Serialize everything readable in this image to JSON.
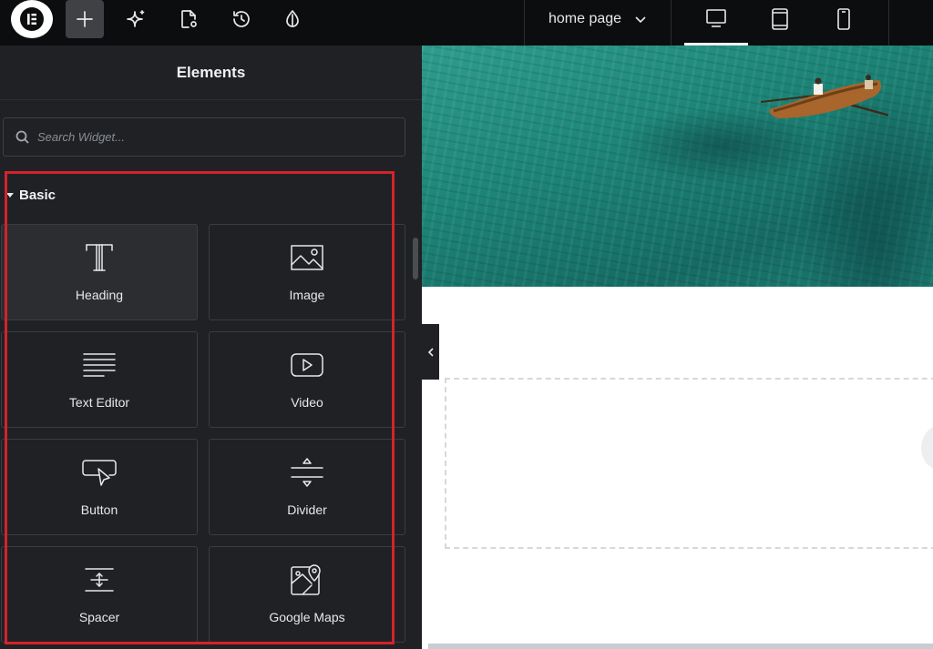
{
  "topbar": {
    "logo_icon": "elementor-logo-icon",
    "tools": [
      {
        "icon": "add-icon",
        "active": true
      },
      {
        "icon": "ai-sparkle-icon"
      },
      {
        "icon": "page-settings-icon"
      },
      {
        "icon": "history-icon"
      },
      {
        "icon": "site-settings-drop-icon"
      }
    ],
    "page_selector": {
      "label": "home page",
      "icon": "chevron-down-icon"
    },
    "devices": [
      {
        "icon": "desktop-icon",
        "active": true
      },
      {
        "icon": "tablet-icon"
      },
      {
        "icon": "mobile-icon"
      }
    ]
  },
  "panel": {
    "title": "Elements",
    "search_placeholder": "Search Widget...",
    "category": "Basic",
    "widgets": [
      {
        "label": "Heading",
        "icon": "heading-icon"
      },
      {
        "label": "Image",
        "icon": "image-icon"
      },
      {
        "label": "Text Editor",
        "icon": "text-editor-icon"
      },
      {
        "label": "Video",
        "icon": "video-icon"
      },
      {
        "label": "Button",
        "icon": "button-icon"
      },
      {
        "label": "Divider",
        "icon": "divider-icon"
      },
      {
        "label": "Spacer",
        "icon": "spacer-icon"
      },
      {
        "label": "Google Maps",
        "icon": "google-maps-icon"
      }
    ],
    "highlight_color": "#d6222a"
  },
  "canvas": {
    "hero_image": "rowing-boat-on-turquoise-water",
    "collapse_icon": "chevron-left-icon"
  },
  "colors": {
    "panel_bg": "#1f2124",
    "topbar_bg": "#0c0d0e",
    "text": "#e6e8ea"
  }
}
